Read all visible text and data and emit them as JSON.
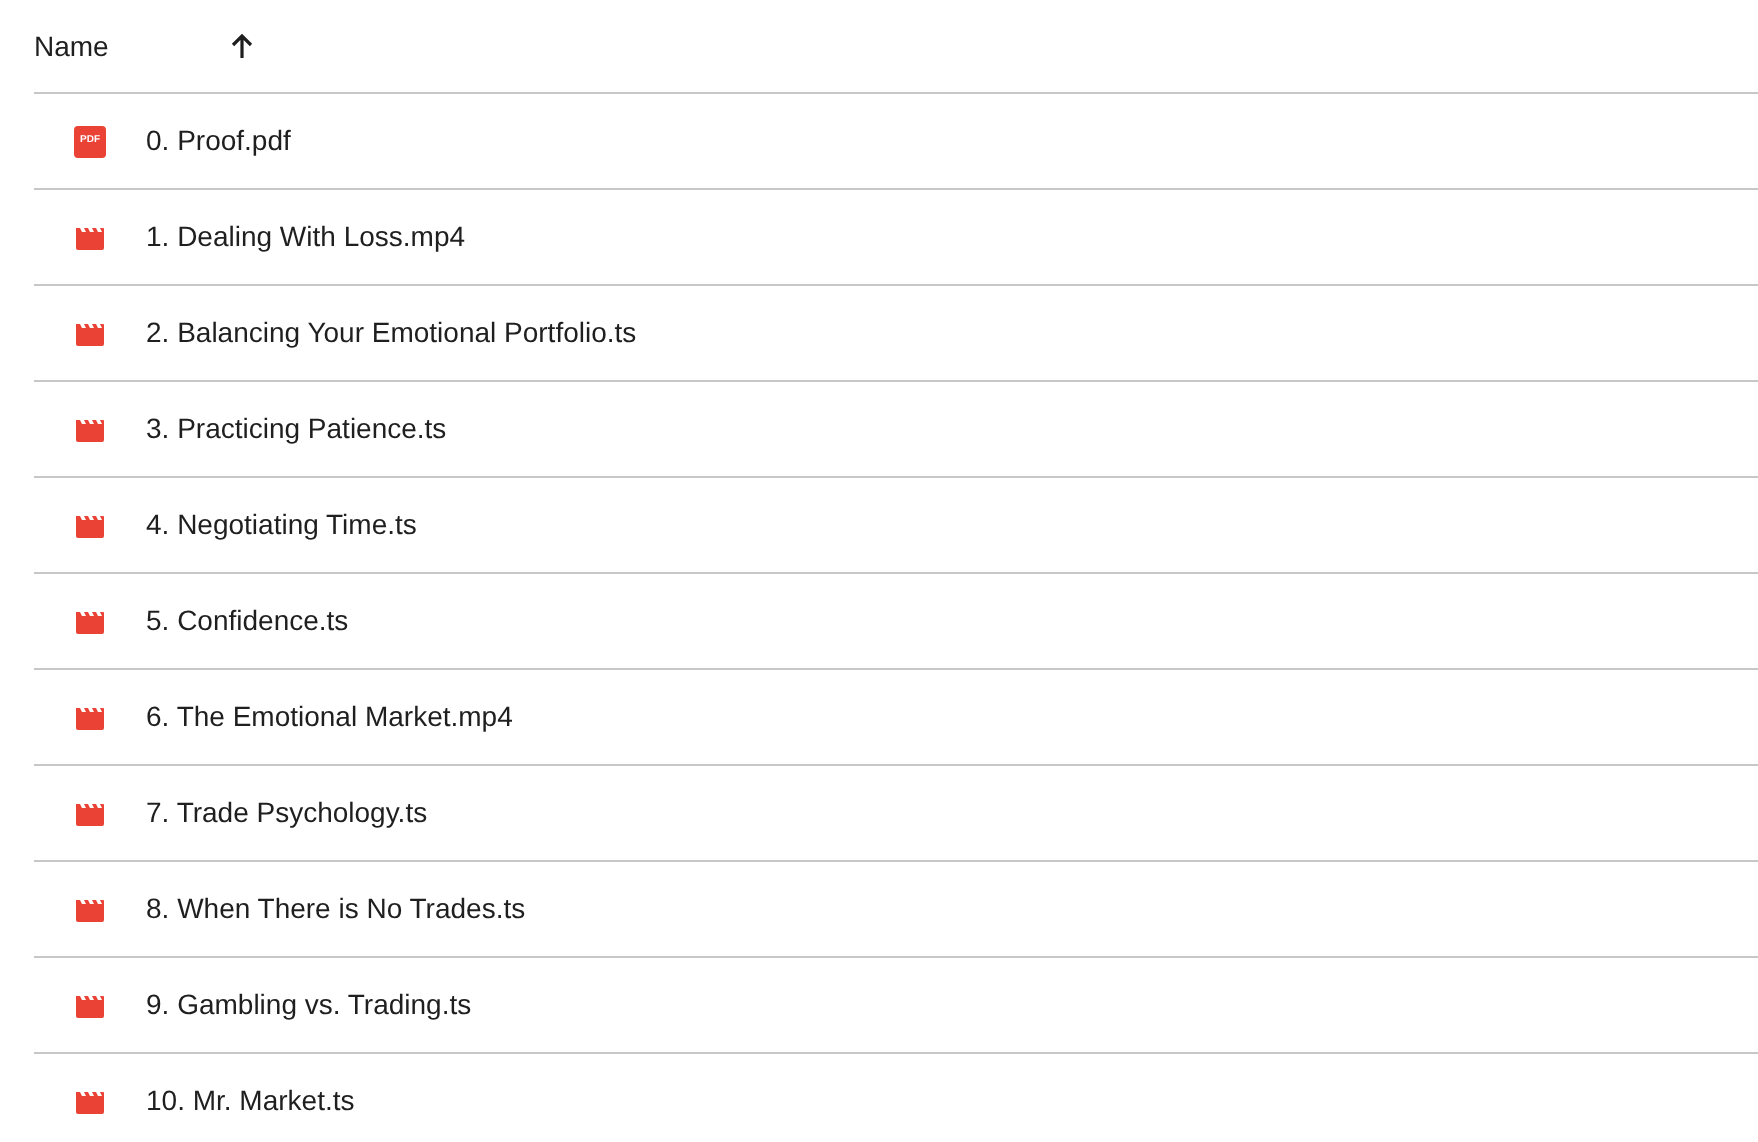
{
  "header": {
    "column": "Name",
    "sort_ascending": true
  },
  "files": [
    {
      "kind": "pdf",
      "icon_label": "PDF",
      "name": "0. Proof.pdf"
    },
    {
      "kind": "video",
      "name": "1. Dealing With Loss.mp4"
    },
    {
      "kind": "video",
      "name": "2. Balancing Your Emotional Portfolio.ts"
    },
    {
      "kind": "video",
      "name": "3. Practicing Patience.ts"
    },
    {
      "kind": "video",
      "name": "4. Negotiating Time.ts"
    },
    {
      "kind": "video",
      "name": "5. Confidence.ts"
    },
    {
      "kind": "video",
      "name": "6. The Emotional Market.mp4"
    },
    {
      "kind": "video",
      "name": "7. Trade Psychology.ts"
    },
    {
      "kind": "video",
      "name": "8. When There is No Trades.ts"
    },
    {
      "kind": "video",
      "name": "9. Gambling vs. Trading.ts"
    },
    {
      "kind": "video",
      "name": "10. Mr. Market.ts"
    }
  ]
}
